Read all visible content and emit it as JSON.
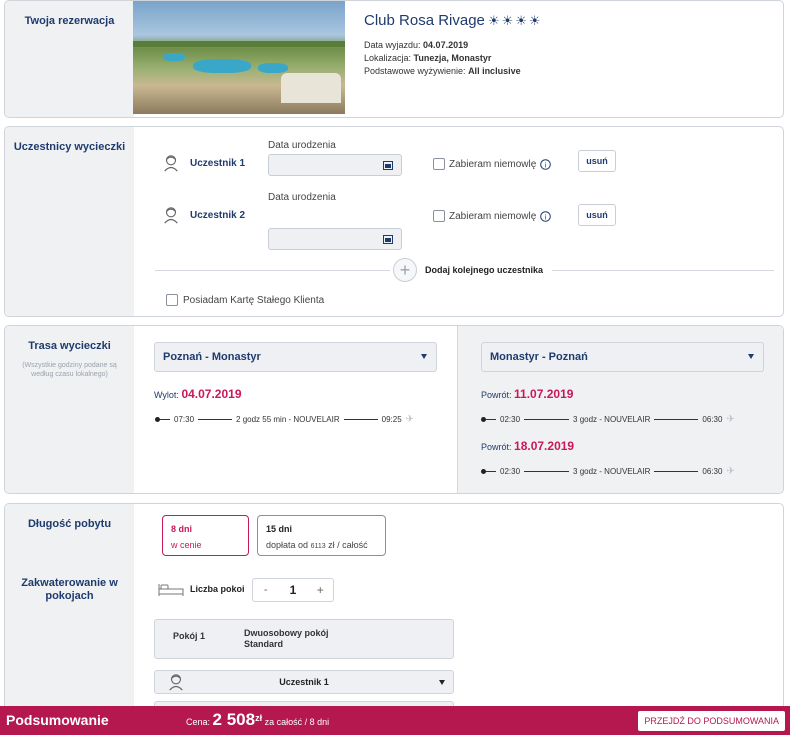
{
  "reservation": {
    "section_title": "Twoja rezerwacja",
    "hotel_name": "Club Rosa Rivage",
    "departure_label": "Data wyjazdu:",
    "departure_value": "04.07.2019",
    "location_label": "Lokalizacja:",
    "location_value": "Tunezja, Monastyr",
    "board_label": "Podstawowe wyżywienie:",
    "board_value": "All inclusive",
    "stars": 4
  },
  "participants": {
    "section_title": "Uczestnicy wycieczki",
    "list": [
      {
        "name": "Uczestnik 1",
        "dob_label": "Data urodzenia",
        "dob_value": "",
        "infant_label": "Zabieram niemowlę",
        "remove_label": "usuń"
      },
      {
        "name": "Uczestnik 2",
        "dob_label": "Data urodzenia",
        "dob_value": "",
        "infant_label": "Zabieram niemowlę",
        "remove_label": "usuń"
      }
    ],
    "add_label": "Dodaj kolejnego uczestnika",
    "loyalty_label": "Posiadam Kartę Stałego Klienta"
  },
  "route": {
    "section_title": "Trasa wycieczki",
    "note": "(Wszystkie godziny podane są według czasu lokalnego)",
    "outbound": {
      "select": "Poznań - Monastyr",
      "label": "Wylot:",
      "date": "04.07.2019",
      "dep": "07:30",
      "info": "2 godz 55 min - NOUVELAIR",
      "arr": "09:25"
    },
    "return_select": "Monastyr - Poznań",
    "returns": [
      {
        "label": "Powrót:",
        "date": "11.07.2019",
        "dep": "02:30",
        "info": "3 godz - NOUVELAIR",
        "arr": "06:30"
      },
      {
        "label": "Powrót:",
        "date": "18.07.2019",
        "dep": "02:30",
        "info": "3 godz - NOUVELAIR",
        "arr": "06:30"
      }
    ]
  },
  "stay": {
    "section_title": "Długość pobytu",
    "options": [
      {
        "days": "8 dni",
        "note": "w cenie",
        "selected": true
      },
      {
        "days": "15 dni",
        "note_prefix": "dopłata od",
        "amount": "6113",
        "note_suffix": "zł / całość",
        "selected": false
      }
    ]
  },
  "rooms": {
    "section_title": "Zakwaterowanie w pokojach",
    "count_label": "Liczba pokoi",
    "minus": "-",
    "count": "1",
    "plus": "+",
    "room_label": "Pokój 1",
    "room_type": "Dwuosobowy pokój Standard",
    "participant_select": "Uczestnik 1"
  },
  "footer": {
    "title": "Podsumowanie",
    "price_label": "Cena:",
    "price_value": "2 508",
    "currency": "zł",
    "price_note": "za całość / 8 dni",
    "cta": "PRZEJDŹ DO PODSUMOWANIA"
  },
  "colors": {
    "navy": "#1f3b6e",
    "accent": "#c8185a",
    "footer": "#b5174f"
  }
}
